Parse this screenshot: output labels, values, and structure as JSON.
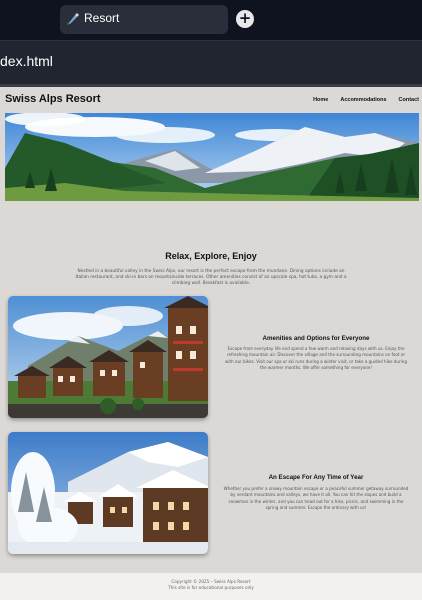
{
  "browser": {
    "tab_title": "Resort",
    "newtab_label": "+",
    "url": "dex.html"
  },
  "site": {
    "title": "Swiss Alps Resort",
    "nav": [
      "Home",
      "Accommodations",
      "Contact"
    ]
  },
  "intro": {
    "title": "Relax, Explore, Enjoy",
    "body": "Nestled in a beautiful valley in the Swiss Alps, our resort is the perfect escape from the mundane. Dining options include an Italian restaurant, and ski-in bars on mountainside terraces. Other amenities consist of an upscale spa, hot tubs, a gym and a climbing wall. Breakfast is available."
  },
  "features": [
    {
      "title": "Amenities and Options for Everyone",
      "body": "Escape from everyday life and spend a few warm and relaxing days with us. Enjoy the refreshing mountain air. Discover the village and the surrounding mountains on foot or with our bikes. Visit our spa or ski runs during a winter visit, or take a guided hike during the warmer months. We offer something for everyone!"
    },
    {
      "title": "An Escape For Any Time of Year",
      "body": "Whether you prefer a snowy mountain escape or a peaceful summer getaway surrounded by verdant mountains and valleys, we have it all. You can hit the slopes and build a snowman in the winter, and you can head out for a hike, picnic, and swimming in the spring and summer. Escape the ordinary with us!"
    }
  ],
  "footer": {
    "copyright": "Copyright © 2025 – Swiss Alps Resort",
    "note": "This site is for educational purposes only"
  }
}
